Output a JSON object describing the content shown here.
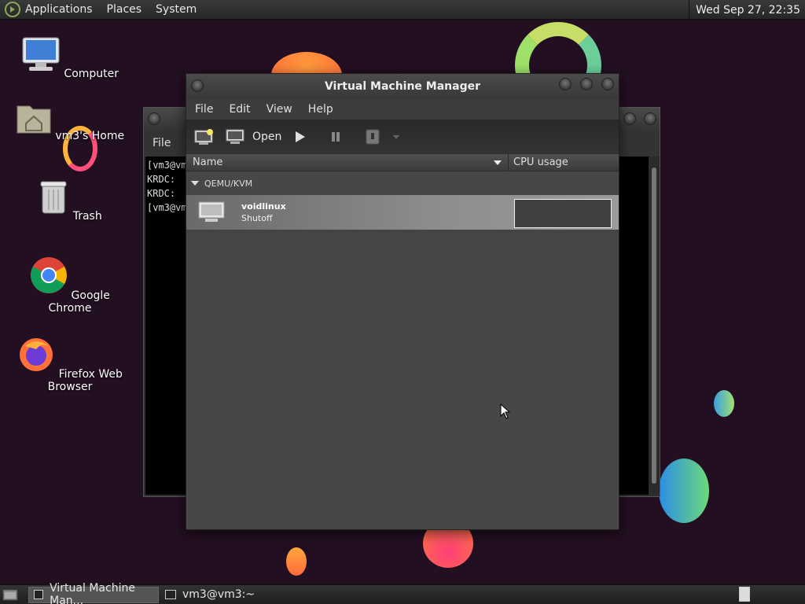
{
  "top_panel": {
    "menus": [
      "Applications",
      "Places",
      "System"
    ],
    "clock": "Wed Sep 27, 22:35"
  },
  "desktop": {
    "icons": [
      {
        "label": "Computer",
        "icon": "computer-icon"
      },
      {
        "label": "vm3's Home",
        "icon": "home-folder-icon"
      },
      {
        "label": "Trash",
        "icon": "trash-icon"
      },
      {
        "label": "Google Chrome",
        "icon": "chrome-icon"
      },
      {
        "label": "Firefox Web Browser",
        "icon": "firefox-icon"
      }
    ]
  },
  "terminal": {
    "menu_file": "File",
    "lines": [
      "[vm3@vm",
      "KRDC: ",
      "KRDC: ",
      "[vm3@vm"
    ]
  },
  "vmm": {
    "title": "Virtual Machine Manager",
    "menus": [
      "File",
      "Edit",
      "View",
      "Help"
    ],
    "toolbar": {
      "open_label": "Open"
    },
    "columns": {
      "name": "Name",
      "cpu": "CPU usage"
    },
    "group": "QEMU/KVM",
    "vms": [
      {
        "name": "voidlinux",
        "status": "Shutoff"
      }
    ]
  },
  "taskbar": {
    "tasks": [
      {
        "label": "Virtual Machine Man...",
        "active": true
      },
      {
        "label": "vm3@vm3:~",
        "active": false
      }
    ]
  },
  "colors": {
    "wallpaper": "#230f22",
    "selected_row": "#8e8e8e"
  }
}
